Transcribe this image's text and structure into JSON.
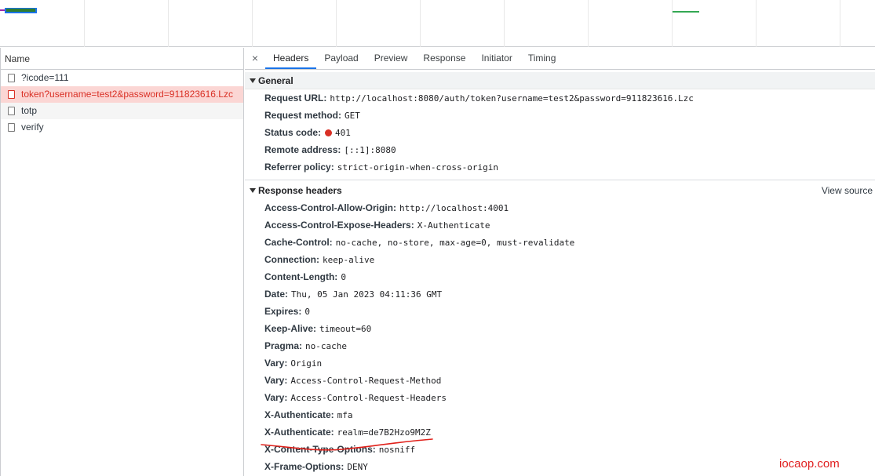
{
  "timeline": {
    "bar_colors": [
      "#2e7d32",
      "#1a73e8",
      "#9c27b0",
      "#34a853"
    ]
  },
  "request_list": {
    "header": "Name",
    "items": [
      {
        "label": "?icode=111",
        "state": "normal"
      },
      {
        "label": "token?username=test2&password=911823616.Lzc",
        "state": "selected"
      },
      {
        "label": "totp",
        "state": "alt"
      },
      {
        "label": "verify",
        "state": "normal"
      }
    ]
  },
  "tabs": {
    "close": "×",
    "items": [
      "Headers",
      "Payload",
      "Preview",
      "Response",
      "Initiator",
      "Timing"
    ],
    "active": "Headers"
  },
  "general": {
    "title": "General",
    "rows": [
      {
        "key": "Request URL:",
        "value": "http://localhost:8080/auth/token?username=test2&password=911823616.Lzc"
      },
      {
        "key": "Request method:",
        "value": "GET"
      },
      {
        "key": "Status code:",
        "value": "401"
      },
      {
        "key": "Remote address:",
        "value": "[::1]:8080"
      },
      {
        "key": "Referrer policy:",
        "value": "strict-origin-when-cross-origin"
      }
    ]
  },
  "response_headers": {
    "title": "Response headers",
    "view_source": "View source",
    "rows": [
      {
        "key": "Access-Control-Allow-Origin:",
        "value": "http://localhost:4001"
      },
      {
        "key": "Access-Control-Expose-Headers:",
        "value": "X-Authenticate"
      },
      {
        "key": "Cache-Control:",
        "value": "no-cache, no-store, max-age=0, must-revalidate"
      },
      {
        "key": "Connection:",
        "value": "keep-alive"
      },
      {
        "key": "Content-Length:",
        "value": "0"
      },
      {
        "key": "Date:",
        "value": "Thu, 05 Jan 2023 04:11:36 GMT"
      },
      {
        "key": "Expires:",
        "value": "0"
      },
      {
        "key": "Keep-Alive:",
        "value": "timeout=60"
      },
      {
        "key": "Pragma:",
        "value": "no-cache"
      },
      {
        "key": "Vary:",
        "value": "Origin"
      },
      {
        "key": "Vary:",
        "value": "Access-Control-Request-Method"
      },
      {
        "key": "Vary:",
        "value": "Access-Control-Request-Headers"
      },
      {
        "key": "X-Authenticate:",
        "value": "mfa"
      },
      {
        "key": "X-Authenticate:",
        "value": "realm=de7B2Hzo9M2Z"
      },
      {
        "key": "X-Content-Type-Options:",
        "value": "nosniff"
      },
      {
        "key": "X-Frame-Options:",
        "value": "DENY"
      }
    ]
  },
  "status_color": "#d93025",
  "accent_color": "#1a73e8",
  "watermark": "iocaop.com"
}
